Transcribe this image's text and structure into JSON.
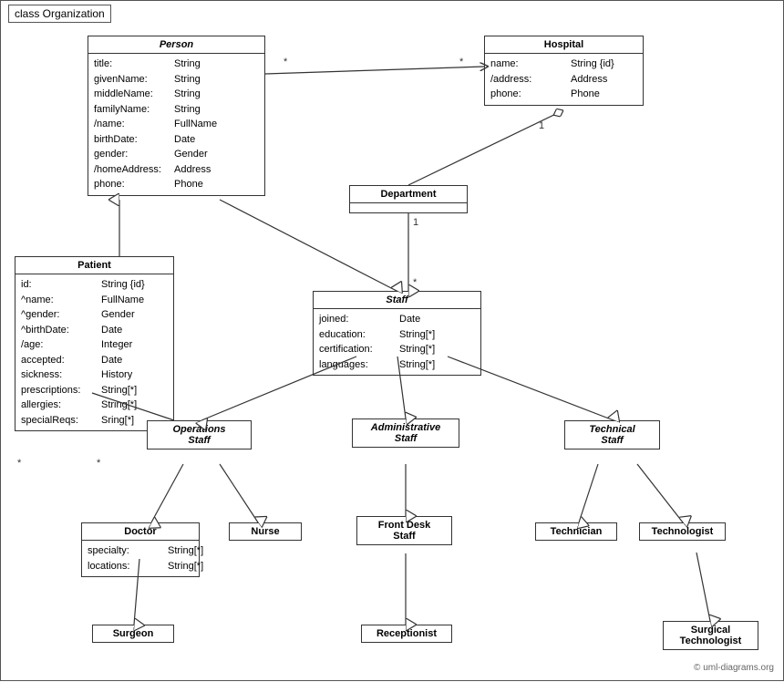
{
  "title": "class Organization",
  "copyright": "© uml-diagrams.org",
  "classes": {
    "person": {
      "name": "Person",
      "italic": true,
      "attrs": [
        {
          "name": "title:",
          "type": "String"
        },
        {
          "name": "givenName:",
          "type": "String"
        },
        {
          "name": "middleName:",
          "type": "String"
        },
        {
          "name": "familyName:",
          "type": "String"
        },
        {
          "name": "/name:",
          "type": "FullName"
        },
        {
          "name": "birthDate:",
          "type": "Date"
        },
        {
          "name": "gender:",
          "type": "Gender"
        },
        {
          "name": "/homeAddress:",
          "type": "Address"
        },
        {
          "name": "phone:",
          "type": "Phone"
        }
      ]
    },
    "hospital": {
      "name": "Hospital",
      "italic": false,
      "attrs": [
        {
          "name": "name:",
          "type": "String {id}"
        },
        {
          "name": "/address:",
          "type": "Address"
        },
        {
          "name": "phone:",
          "type": "Phone"
        }
      ]
    },
    "patient": {
      "name": "Patient",
      "italic": false,
      "attrs": [
        {
          "name": "id:",
          "type": "String {id}"
        },
        {
          "name": "^name:",
          "type": "FullName"
        },
        {
          "name": "^gender:",
          "type": "Gender"
        },
        {
          "name": "^birthDate:",
          "type": "Date"
        },
        {
          "name": "/age:",
          "type": "Integer"
        },
        {
          "name": "accepted:",
          "type": "Date"
        },
        {
          "name": "sickness:",
          "type": "History"
        },
        {
          "name": "prescriptions:",
          "type": "String[*]"
        },
        {
          "name": "allergies:",
          "type": "String[*]"
        },
        {
          "name": "specialReqs:",
          "type": "Sring[*]"
        }
      ]
    },
    "department": {
      "name": "Department",
      "italic": false,
      "attrs": []
    },
    "staff": {
      "name": "Staff",
      "italic": true,
      "attrs": [
        {
          "name": "joined:",
          "type": "Date"
        },
        {
          "name": "education:",
          "type": "String[*]"
        },
        {
          "name": "certification:",
          "type": "String[*]"
        },
        {
          "name": "languages:",
          "type": "String[*]"
        }
      ]
    },
    "operations_staff": {
      "name": "Operations\nStaff",
      "italic": true,
      "attrs": []
    },
    "administrative_staff": {
      "name": "Administrative\nStaff",
      "italic": true,
      "attrs": []
    },
    "technical_staff": {
      "name": "Technical\nStaff",
      "italic": true,
      "attrs": []
    },
    "doctor": {
      "name": "Doctor",
      "italic": false,
      "attrs": [
        {
          "name": "specialty:",
          "type": "String[*]"
        },
        {
          "name": "locations:",
          "type": "String[*]"
        }
      ]
    },
    "nurse": {
      "name": "Nurse",
      "italic": false,
      "attrs": []
    },
    "front_desk_staff": {
      "name": "Front Desk\nStaff",
      "italic": false,
      "attrs": []
    },
    "technician": {
      "name": "Technician",
      "italic": false,
      "attrs": []
    },
    "technologist": {
      "name": "Technologist",
      "italic": false,
      "attrs": []
    },
    "surgeon": {
      "name": "Surgeon",
      "italic": false,
      "attrs": []
    },
    "receptionist": {
      "name": "Receptionist",
      "italic": false,
      "attrs": []
    },
    "surgical_technologist": {
      "name": "Surgical\nTechnologist",
      "italic": false,
      "attrs": []
    }
  }
}
